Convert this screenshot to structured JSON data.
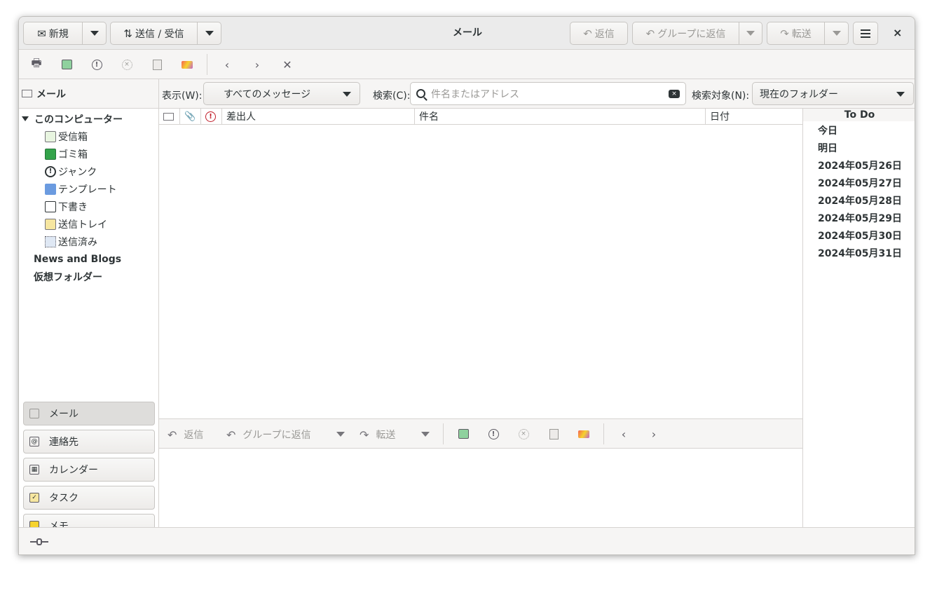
{
  "window": {
    "title": "メール"
  },
  "headerbar": {
    "new_label": "新規",
    "send_receive_label": "送信 / 受信",
    "reply_label": "返信",
    "reply_all_label": "グループに返信",
    "forward_label": "転送",
    "close_label": "×"
  },
  "folder_pane": {
    "header": "メール",
    "root": "このコンピューター",
    "folders": [
      {
        "label": "受信箱",
        "icon": "inbox-icon"
      },
      {
        "label": "ゴミ箱",
        "icon": "trash-icon"
      },
      {
        "label": "ジャンク",
        "icon": "junk-icon"
      },
      {
        "label": "テンプレート",
        "icon": "templates-icon"
      },
      {
        "label": "下書き",
        "icon": "drafts-icon"
      },
      {
        "label": "送信トレイ",
        "icon": "outbox-icon"
      },
      {
        "label": "送信済み",
        "icon": "sent-icon"
      }
    ],
    "top_level": [
      "News and Blogs",
      "仮想フォルダー"
    ]
  },
  "nav_buttons": [
    {
      "label": "メール",
      "icon": "mail-icon"
    },
    {
      "label": "連絡先",
      "icon": "contacts-icon"
    },
    {
      "label": "カレンダー",
      "icon": "calendar-icon"
    },
    {
      "label": "タスク",
      "icon": "tasks-icon"
    },
    {
      "label": "メモ",
      "icon": "memos-icon"
    }
  ],
  "search_bar": {
    "show_label": "表示(W):",
    "show_value": "すべてのメッセージ",
    "search_label": "検索(C):",
    "search_placeholder": "件名またはアドレス",
    "scope_label": "検索対象(N):",
    "scope_value": "現在のフォルダー"
  },
  "message_list": {
    "columns": {
      "from": "差出人",
      "subject": "件名",
      "date": "日付"
    }
  },
  "message_toolbar": {
    "reply_label": "返信",
    "reply_all_label": "グループに返信",
    "forward_label": "転送"
  },
  "todo": {
    "title": "To Do",
    "rows": [
      "今日",
      "明日",
      "2024年05月26日",
      "2024年05月27日",
      "2024年05月28日",
      "2024年05月29日",
      "2024年05月30日",
      "2024年05月31日"
    ]
  }
}
